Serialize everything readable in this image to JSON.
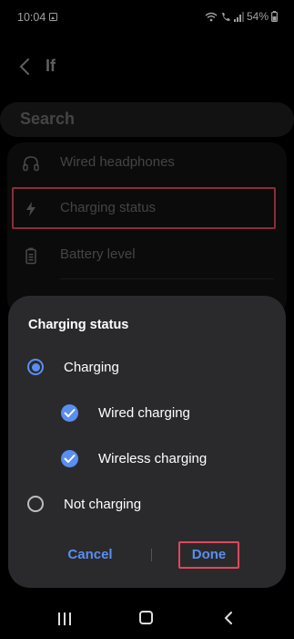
{
  "status_bar": {
    "time": "10:04",
    "battery": "54%"
  },
  "header": {
    "title": "If"
  },
  "search": {
    "label": "Search"
  },
  "list": {
    "items": [
      {
        "label": "Wired headphones",
        "icon": "headphones-icon"
      },
      {
        "label": "Charging status",
        "icon": "bolt-icon"
      },
      {
        "label": "Battery level",
        "icon": "battery-icon"
      }
    ]
  },
  "dialog": {
    "title": "Charging status",
    "options": {
      "charging": {
        "label": "Charging",
        "selected": true
      },
      "wired_charging": {
        "label": "Wired charging",
        "checked": true
      },
      "wireless_charging": {
        "label": "Wireless charging",
        "checked": true
      },
      "not_charging": {
        "label": "Not charging",
        "selected": false
      }
    },
    "cancel_label": "Cancel",
    "done_label": "Done"
  },
  "colors": {
    "accent": "#5a8ef0",
    "highlight": "#e0475e",
    "dialog_bg": "#2a2a2c"
  }
}
